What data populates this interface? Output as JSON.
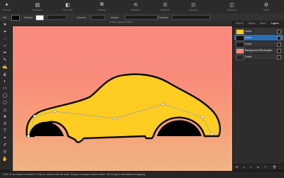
{
  "toolbar": {
    "groups": [
      {
        "label": "Persona",
        "icon": "persona-icon"
      },
      {
        "label": "Document",
        "icon": "document-icon"
      },
      {
        "label": "View mode",
        "icon": "view-mode-icon"
      },
      {
        "label": "Arrange",
        "icon": "arrange-icon"
      },
      {
        "label": "Transform",
        "icon": "transform-icon"
      },
      {
        "label": "Alignment",
        "icon": "alignment-icon"
      },
      {
        "label": "Snapping",
        "icon": "snapping-icon"
      },
      {
        "label": "Geometry",
        "icon": "geometry-icon"
      },
      {
        "label": "Studio",
        "icon": "studio-icon"
      }
    ]
  },
  "context_bar": {
    "fill_label": "Fill:",
    "stroke_label": "Stroke:",
    "fill_color": "#000000",
    "stroke_color": "#ffffff",
    "curves_label": "Curves",
    "action_label": "Action",
    "convert_label": "Convert"
  },
  "document": {
    "title": "Untitled.afdesign (100%)"
  },
  "layers_panel": {
    "tabs": [
      "Layers",
      "Effects",
      "Styles",
      "Stock"
    ],
    "active_tab": "Layers",
    "layers": [
      {
        "name": "Curve",
        "thumb_color": "#ffcc22",
        "selected": false
      },
      {
        "name": "Curve",
        "thumb_color": "#111111",
        "selected": true
      },
      {
        "name": "Curve",
        "thumb_color": "#1a1a1a",
        "selected": false
      },
      {
        "name": "Background (Rectangle)",
        "thumb_color": "#f98a7e",
        "selected": false
      },
      {
        "name": "Curve",
        "thumb_color": "#2a2a2a",
        "selected": false
      }
    ]
  },
  "status": {
    "text": "Click on an object to select it. Click on node to edit its node. Drag to marquee select nodes. Ctrl+Drag to edit without snapping."
  },
  "colors": {
    "car_body": "#ffcc22",
    "wheel": "#000000",
    "accent": "#2a6fb6"
  }
}
